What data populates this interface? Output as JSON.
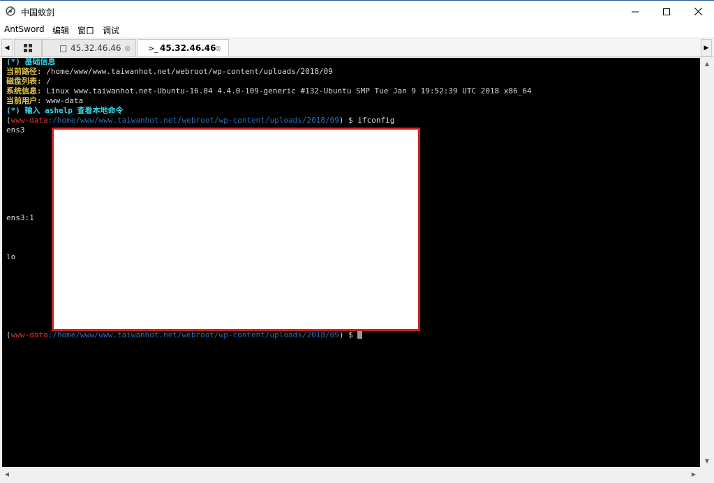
{
  "window": {
    "title": "中国蚁剑",
    "minimize_glyph": "—",
    "maximize_glyph": "☐",
    "close_glyph": "✕"
  },
  "menu": {
    "items": [
      "AntSword",
      "编辑",
      "窗口",
      "调试"
    ]
  },
  "tabs": {
    "left_arrow": "◀",
    "right_arrow": "▶",
    "grid_icon": "grid-icon",
    "items": [
      {
        "icon": "□",
        "label": "45.32.46.46",
        "close": "⊗"
      },
      {
        "icon": ">_",
        "label": "45.32.46.46",
        "close": "⊗"
      }
    ]
  },
  "terminal": {
    "header": "(*) 基础信息",
    "path_label": "当前路径:",
    "path_value": " /home/www/www.taiwanhot.net/webroot/wp-content/uploads/2018/09",
    "disk_label": "磁盘列表:",
    "disk_value": " /",
    "sys_label": "系统信息:",
    "sys_value": " Linux www.taiwanhot.net-Ubuntu-16.04 4.4.0-109-generic #132-Ubuntu SMP Tue Jan 9 19:52:39 UTC 2018 x86_64",
    "user_label": "当前用户:",
    "user_value": " www-data",
    "hint": "(*) 输入 ashelp 查看本地命令",
    "prompt1": {
      "open": "(",
      "user": "www-data",
      "path": ":/home/www/www.taiwanhot.net/webroot/wp-content/uploads/2018/09",
      "close": ") $ ",
      "command": "ifconfig"
    },
    "iface1": "ens3",
    "iface2": "ens3:1",
    "iface3": "lo",
    "prompt2": {
      "open": "(",
      "user": "www-data",
      "path": ":/home/www/www.taiwanhot.net/webroot/wp-content/uploads/2018/09",
      "close": ") $ "
    }
  },
  "scrollbars": {
    "up": "▲",
    "down": "▼",
    "left": "◀",
    "right": "▶"
  }
}
